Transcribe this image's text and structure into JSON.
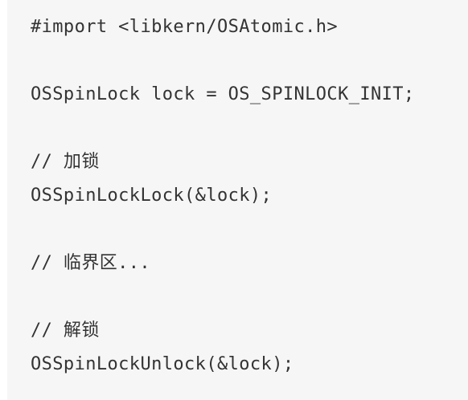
{
  "code": {
    "language": "objective-c",
    "lines": [
      "#import <libkern/OSAtomic.h>",
      "",
      "OSSpinLock lock = OS_SPINLOCK_INIT;",
      "",
      "// 加锁",
      "OSSpinLockLock(&lock);",
      "",
      "// 临界区...",
      "",
      "// 解锁",
      "OSSpinLockUnlock(&lock);"
    ]
  }
}
